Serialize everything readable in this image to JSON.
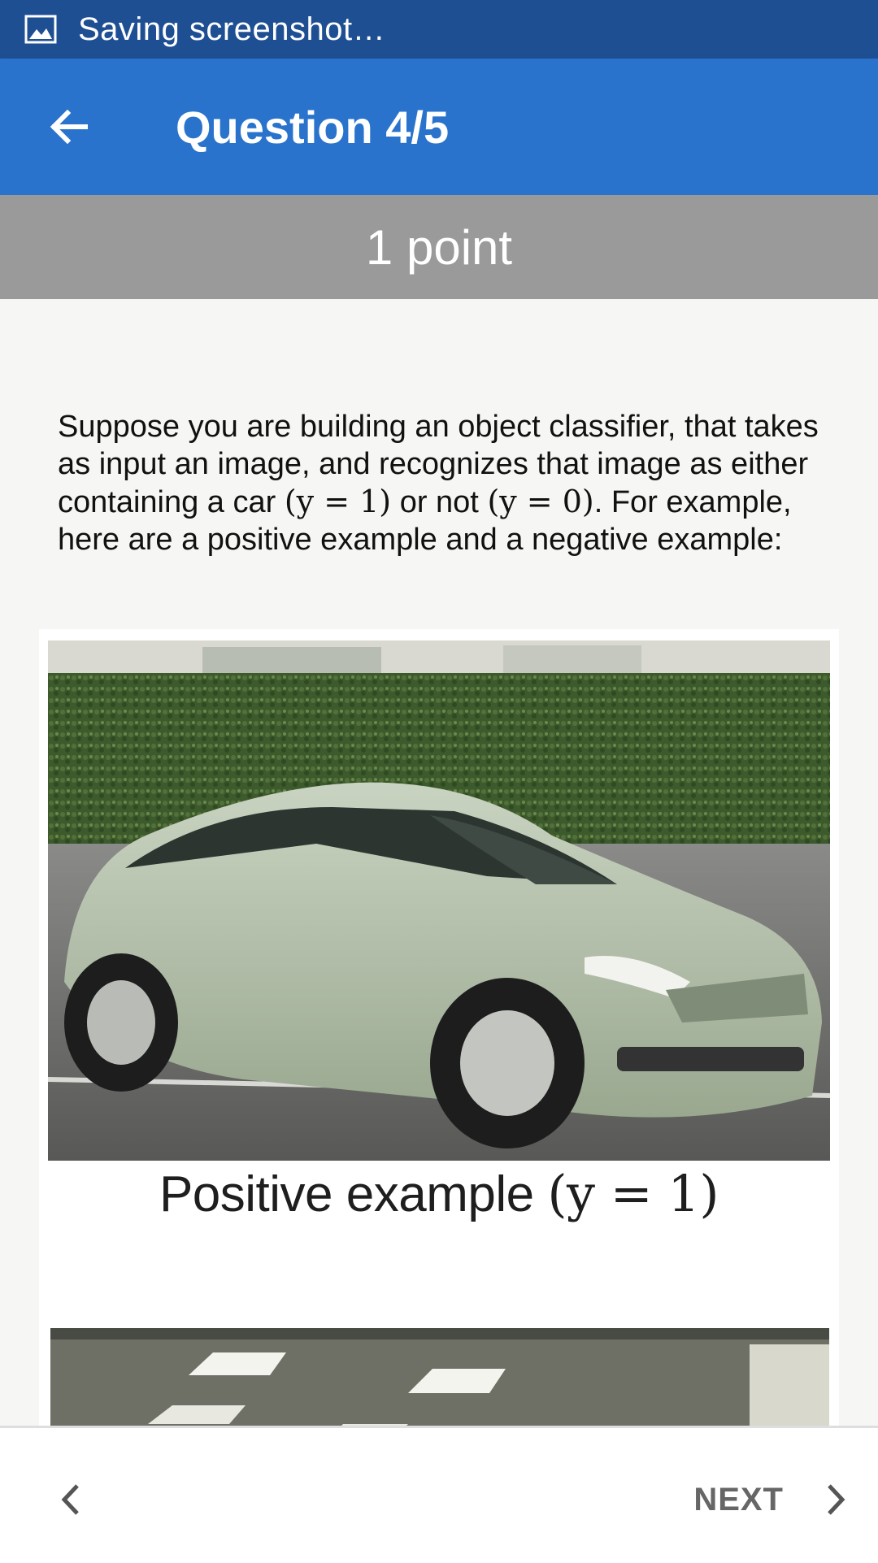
{
  "status_bar": {
    "icon": "image-icon",
    "text": "Saving screenshot…",
    "color": "#1f4f93"
  },
  "app_bar": {
    "back_icon": "arrow-back-icon",
    "title": "Question 4/5",
    "color": "#2a73cc"
  },
  "points": {
    "label": "1 point",
    "color": "#9a9a9a"
  },
  "question": {
    "line1": "Suppose you are building an object classifier, that takes as input an image, and recognizes that image as either containing a car ",
    "math1": "(y = 1)",
    "line2": " or not ",
    "math2": "(y = 0)",
    "line3": ". For example, here are a positive example and a negative example:"
  },
  "images": {
    "positive_caption_text": "Positive example ",
    "positive_caption_math": "(y = 1)"
  },
  "navigation": {
    "prev_icon": "chevron-left-icon",
    "next_label": "NEXT",
    "next_icon": "chevron-right-icon"
  }
}
